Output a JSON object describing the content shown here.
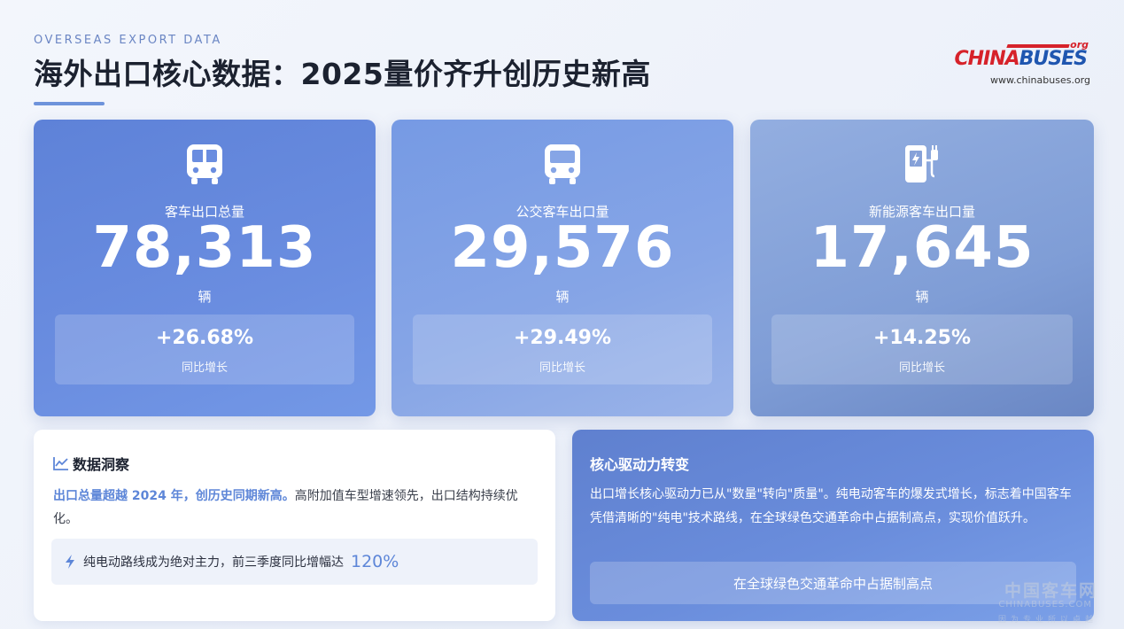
{
  "header": {
    "subtitle": "OVERSEAS EXPORT DATA",
    "title": "海外出口核心数据：2025量价齐升创历史新高"
  },
  "logo": {
    "word_china": "CHINA",
    "word_buses": "BUSES",
    "org": ".org",
    "url": "www.chinabuses.org"
  },
  "cards": [
    {
      "icon": "bus-front-icon",
      "label": "客车出口总量",
      "value": "78,313",
      "unit": "辆",
      "growth": "+26.68%",
      "growth_label": "同比增长"
    },
    {
      "icon": "city-bus-icon",
      "label": "公交客车出口量",
      "value": "29,576",
      "unit": "辆",
      "growth": "+29.49%",
      "growth_label": "同比增长"
    },
    {
      "icon": "ev-charger-icon",
      "label": "新能源客车出口量",
      "value": "17,645",
      "unit": "辆",
      "growth": "+14.25%",
      "growth_label": "同比增长"
    }
  ],
  "insight": {
    "title": "数据洞察",
    "highlight": "出口总量超越 2024 年，创历史同期新高。",
    "text": "高附加值车型增速领先，出口结构持续优化。",
    "box_text": "纯电动路线成为绝对主力，前三季度同比增幅达",
    "box_value": "120%"
  },
  "driver": {
    "title": "核心驱动力转变",
    "text": "出口增长核心驱动力已从\"数量\"转向\"质量\"。纯电动客车的爆发式增长，标志着中国客车凭借清晰的\"纯电\"技术路线，在全球绿色交通革命中占据制高点，实现价值跃升。",
    "button": "在全球绿色交通革命中占据制高点"
  },
  "watermark": {
    "cn": "中国客车网",
    "en": "CHINABUSES.COM",
    "tagline": "因为专业所以卓越"
  },
  "colors": {
    "accent": "#5d86d8",
    "logo_red": "#d6222a",
    "logo_blue": "#1f56b0"
  }
}
